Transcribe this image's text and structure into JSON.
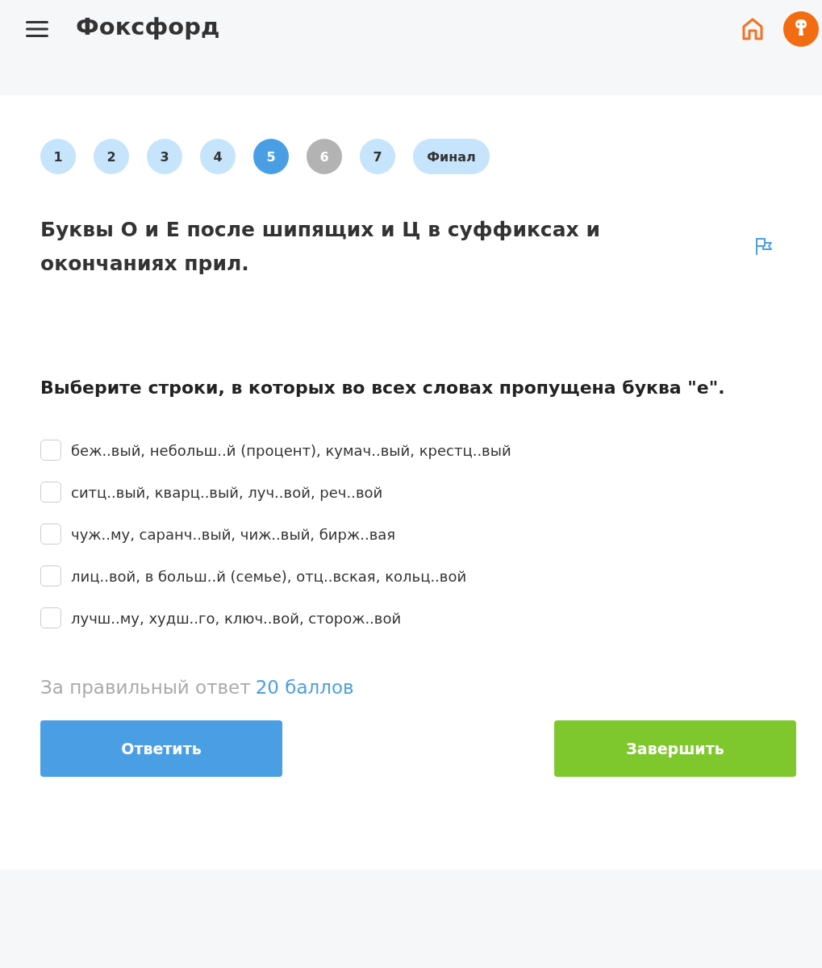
{
  "header": {
    "logo": "Фоксфорд"
  },
  "steps": [
    {
      "label": "1",
      "selected": false,
      "skipped": false
    },
    {
      "label": "2",
      "selected": false,
      "skipped": false
    },
    {
      "label": "3",
      "selected": false,
      "skipped": false
    },
    {
      "label": "4",
      "selected": false,
      "skipped": false
    },
    {
      "label": "5",
      "selected": true,
      "skipped": false
    },
    {
      "label": "6",
      "selected": false,
      "skipped": true
    },
    {
      "label": "7",
      "selected": false,
      "skipped": false
    },
    {
      "label": "Финал",
      "selected": false,
      "skipped": false
    }
  ],
  "title": "Буквы О и Е после шипящих и Ц в суффиксах и окончаниях прил.",
  "question": "Выберите строки, в которых во всех словах пропущена буква \"е\".",
  "options": [
    {
      "text": "беж..вый, небольш..й (процент), кумач..вый, крестц..вый",
      "checked": false
    },
    {
      "text": "ситц..вый, кварц..вый, луч..вой, реч..вой",
      "checked": false
    },
    {
      "text": "чуж..му, саранч..вый, чиж..вый, бирж..вая",
      "checked": false
    },
    {
      "text": "лиц..вой, в больш..й (семье), отц..вская, кольц..вой",
      "checked": false
    },
    {
      "text": "лучш..му, худш..го, ключ..вой, сторож..вой",
      "checked": false
    }
  ],
  "points": {
    "label": "За правильный ответ",
    "value": "20 баллов"
  },
  "buttons": {
    "answer": "Ответить",
    "finish": "Завершить"
  }
}
